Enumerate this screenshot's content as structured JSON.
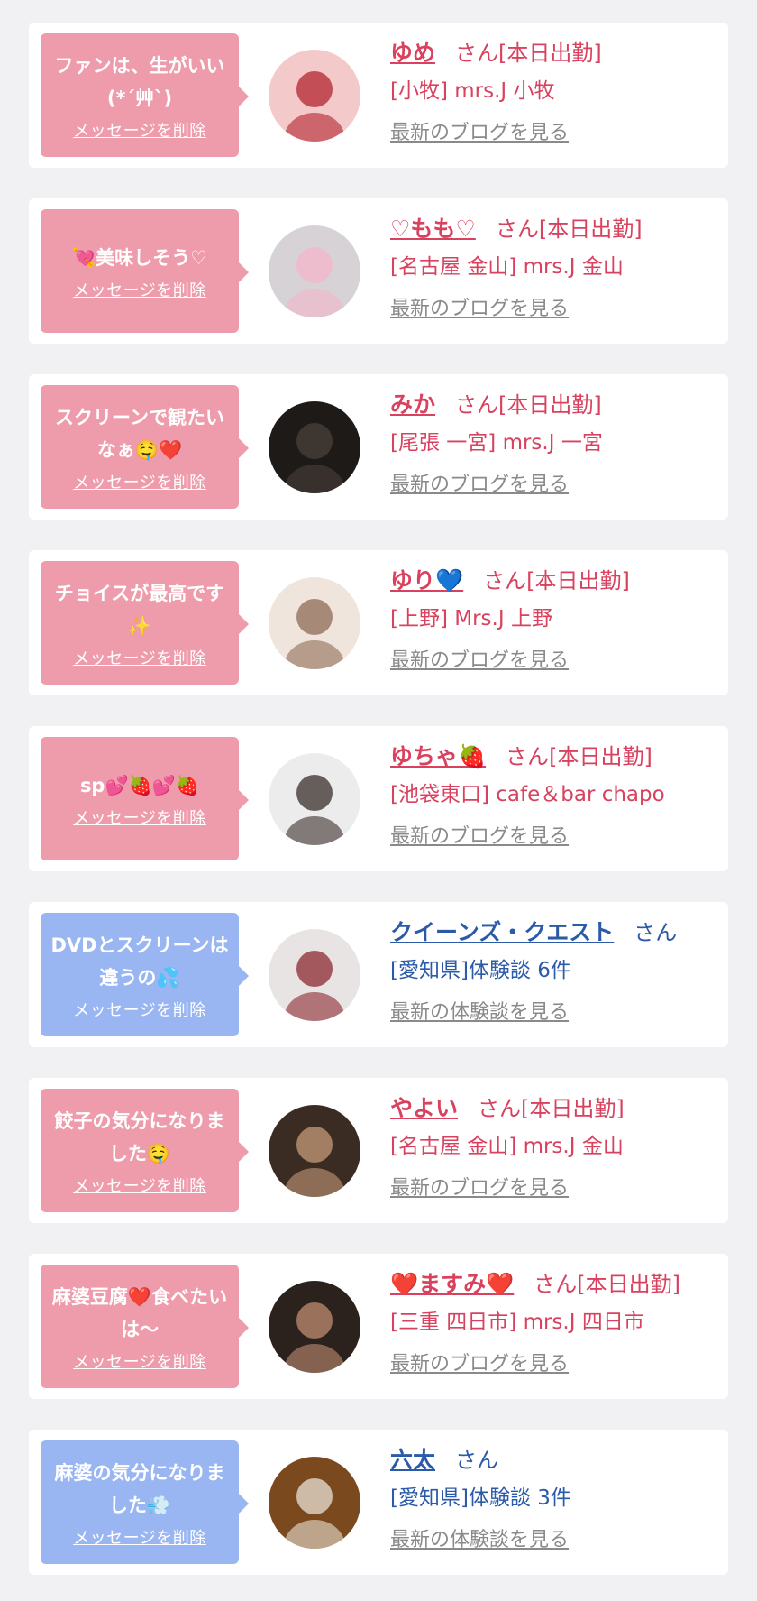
{
  "delete_label": "メッセージを削除",
  "cards": [
    {
      "message": "ファンは、生がいい(*´艸`)",
      "name": "ゆめ",
      "suffix": "さん[本日出勤]",
      "line2": "[小牧] mrs.J 小牧",
      "link": "最新のブログを見る",
      "bubble": "pink",
      "theme": "red",
      "avatar_colors": [
        "#f3c9c9",
        "#b3242f"
      ]
    },
    {
      "message": "💘美味しそう♡",
      "name": "♡もも♡",
      "suffix": "さん[本日出勤]",
      "line2": "[名古屋 金山] mrs.J 金山",
      "link": "最新のブログを見る",
      "bubble": "pink",
      "theme": "red",
      "avatar_colors": [
        "#d7d2d6",
        "#f4b6c9"
      ]
    },
    {
      "message": "スクリーンで観たいなぁ🤤❤️",
      "name": "みか",
      "suffix": "さん[本日出勤]",
      "line2": "[尾張 一宮] mrs.J 一宮",
      "link": "最新のブログを見る",
      "bubble": "pink",
      "theme": "red",
      "avatar_colors": [
        "#1e1a18",
        "#4a403a"
      ]
    },
    {
      "message": "チョイスが最高です✨",
      "name": "ゆり💙",
      "suffix": "さん[本日出勤]",
      "line2": "[上野] Mrs.J 上野",
      "link": "最新のブログを見る",
      "bubble": "pink",
      "theme": "red",
      "avatar_colors": [
        "#efe5dc",
        "#8f6a55"
      ]
    },
    {
      "message": "sp💕🍓💕🍓",
      "name": "ゆちゃ🍓",
      "suffix": "さん[本日出勤]",
      "line2": "[池袋東口] cafe＆bar chapo",
      "link": "最新のブログを見る",
      "bubble": "pink",
      "theme": "red",
      "avatar_colors": [
        "#ececec",
        "#3a2f2b"
      ]
    },
    {
      "message": "DVDとスクリーンは違うの💦",
      "name": "クイーンズ・クエスト",
      "suffix": "さん",
      "line2": "[愛知県]体験談 6件",
      "link": "最新の体験談を見る",
      "bubble": "blue",
      "theme": "navy",
      "avatar_colors": [
        "#e9e4e4",
        "#8a2a30"
      ]
    },
    {
      "message": "餃子の気分になりました🤤",
      "name": "やよい",
      "suffix": "さん[本日出勤]",
      "line2": "[名古屋 金山] mrs.J 金山",
      "link": "最新のブログを見る",
      "bubble": "pink",
      "theme": "red",
      "avatar_colors": [
        "#3a2c22",
        "#c59a7a"
      ]
    },
    {
      "message": "麻婆豆腐❤️食べたいは〜",
      "name": "❤️ますみ❤️",
      "suffix": "さん[本日出勤]",
      "line2": "[三重 四日市] mrs.J 四日市",
      "link": "最新のブログを見る",
      "bubble": "pink",
      "theme": "red",
      "avatar_colors": [
        "#2b211d",
        "#c08e72"
      ]
    },
    {
      "message": "麻婆の気分になりました💨",
      "name": "六太",
      "suffix": "さん",
      "line2": "[愛知県]体験談 3件",
      "link": "最新の体験談を見る",
      "bubble": "blue",
      "theme": "navy",
      "avatar_colors": [
        "#7a4a1e",
        "#e9e2d6"
      ]
    }
  ]
}
